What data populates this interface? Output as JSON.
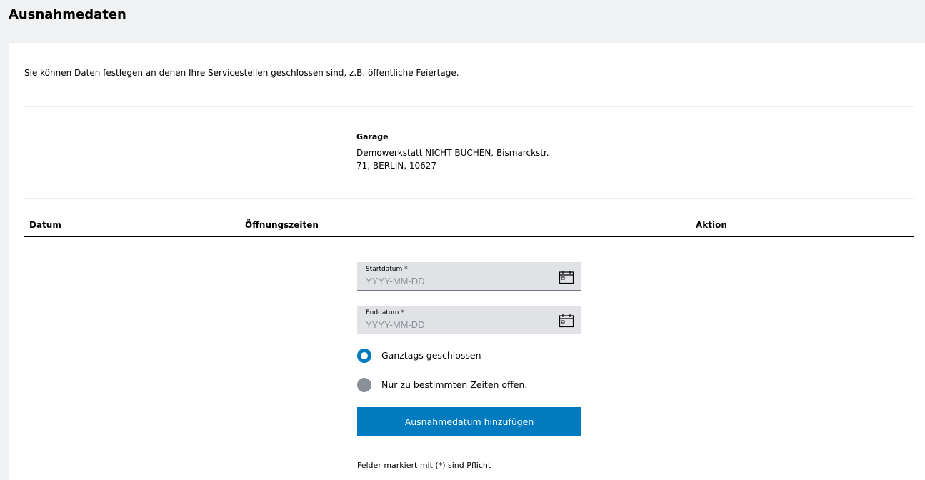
{
  "header": {
    "title": "Ausnahmedaten"
  },
  "intro": {
    "text": "Sie können Daten festlegen an denen Ihre Servicestellen geschlossen sind, z.B. öffentliche Feiertage."
  },
  "garage": {
    "label": "Garage",
    "address_line1": "Demowerkstatt NICHT BUCHEN, Bismarckstr.",
    "address_line2": "71, BERLIN, 10627"
  },
  "table": {
    "columns": [
      "Datum",
      "Öffnungszeiten",
      "Aktion"
    ]
  },
  "form": {
    "start": {
      "label": "Startdatum *",
      "placeholder": "YYYY-MM-DD",
      "value": ""
    },
    "end": {
      "label": "Enddatum *",
      "placeholder": "YYYY-MM-DD",
      "value": ""
    },
    "options": [
      {
        "label": "Ganztags geschlossen",
        "selected": true
      },
      {
        "label": "Nur zu bestimmten Zeiten offen.",
        "selected": false
      }
    ],
    "submit_label": "Ausnahmedatum hinzufügen",
    "required_note": "Felder markiert mit (*) sind Pflicht"
  },
  "icons": {
    "date_picker": "calendar-icon"
  },
  "colors": {
    "primary": "#007bc0",
    "field_bg": "#e0e2e5",
    "page_bg": "#eff1f2",
    "radio_off": "#8a9097"
  }
}
